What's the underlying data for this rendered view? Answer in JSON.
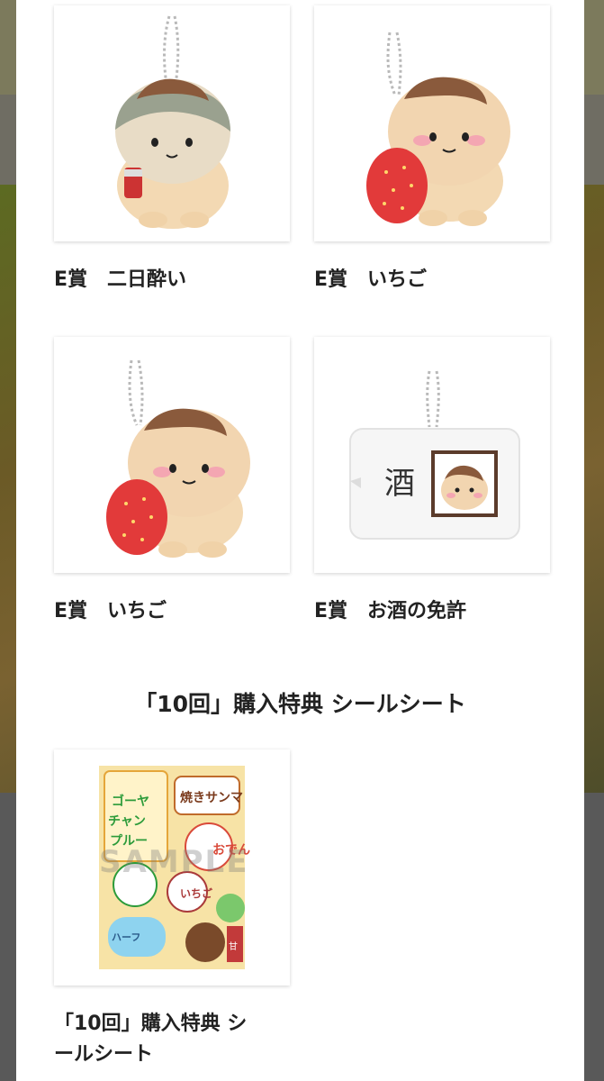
{
  "items": [
    {
      "label": "E賞　二日酔い",
      "icon": "plush-hangover-image"
    },
    {
      "label": "E賞　いちご",
      "icon": "plush-strawberry-image"
    },
    {
      "label": "E賞　いちご",
      "icon": "plush-strawberry-image"
    },
    {
      "label": "E賞　お酒の免許",
      "icon": "pouch-license-image"
    }
  ],
  "bonus": {
    "section_title": "「10回」購入特典 シールシート",
    "label": "「10回」購入特典 シ\nールシート",
    "watermark": "SAMPLE",
    "icon": "sticker-sheet-image"
  }
}
